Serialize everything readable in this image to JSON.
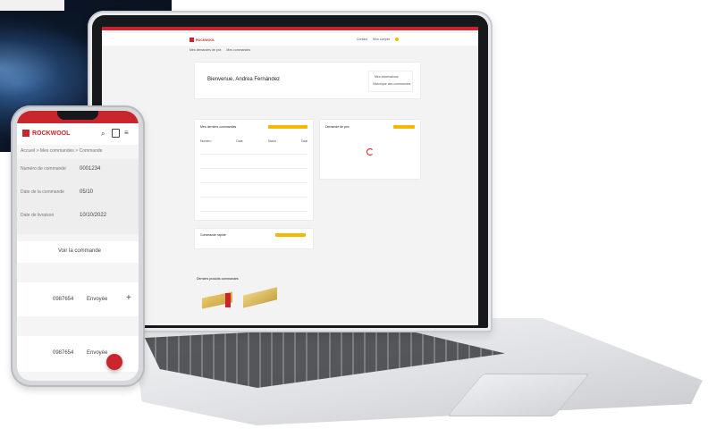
{
  "laptop": {
    "topbar_text": "Rockwool",
    "brand": "ROCKWOOL",
    "nav": [
      "Mes demandes de prix",
      "Mes commandes"
    ],
    "header_links": [
      "Contact",
      "Mon compte"
    ],
    "welcome": "Bienvenue, Andrea Fernández",
    "account_box": [
      "Mes informations",
      "Historique des commandes"
    ],
    "orders_title": "Mes derniers commandes",
    "orders_button": "Voir toutes les commandes",
    "orders_columns": [
      "Numéro",
      "Date",
      "Statut",
      "Total"
    ],
    "price_requests_title": "Demande de prix",
    "price_requests_button": "Voir",
    "quick_order_title": "Commande rapide",
    "quick_order_button": "Commander",
    "products_title": "Derniers produits commandés"
  },
  "phone": {
    "brand": "ROCKWOOL",
    "breadcrumb": "Accueil > Mes commandes > Commande",
    "fields": [
      {
        "label": "Numéro de commande",
        "value": "0001234"
      },
      {
        "label": "Date de la commande",
        "value": "05/10"
      },
      {
        "label": "Date de livraison",
        "value": "10/10/2022"
      }
    ],
    "section": "Voir la commande",
    "items": [
      {
        "ref": "0987654",
        "status": "Envoyée"
      },
      {
        "ref": "0987654",
        "status": "Envoyée"
      }
    ]
  },
  "colors": {
    "brand_red": "#c9252c",
    "accent_yellow": "#f5b800"
  }
}
